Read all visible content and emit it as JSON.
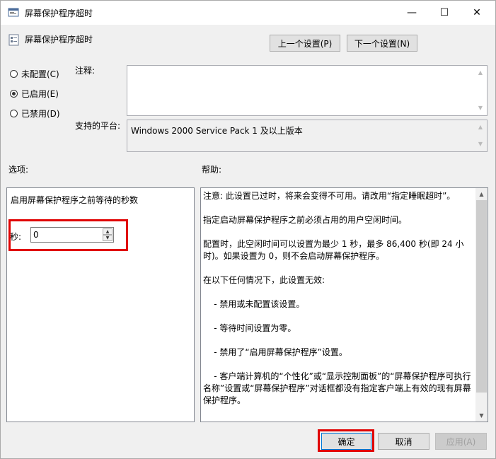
{
  "window": {
    "title": "屏幕保护程序超时",
    "controls": {
      "minimize": "—",
      "maximize": "☐",
      "close": "✕"
    }
  },
  "header": {
    "title": "屏幕保护程序超时",
    "prev_button": "上一个设置(P)",
    "next_button": "下一个设置(N)"
  },
  "state": {
    "options": [
      {
        "label": "未配置(C)",
        "checked": false
      },
      {
        "label": "已启用(E)",
        "checked": true
      },
      {
        "label": "已禁用(D)",
        "checked": false
      }
    ]
  },
  "comment": {
    "label": "注释:",
    "value": ""
  },
  "platform": {
    "label": "支持的平台:",
    "value": "Windows 2000 Service Pack 1 及以上版本"
  },
  "options_section": {
    "label": "选项:",
    "description": "启用屏幕保护程序之前等待的秒数",
    "seconds_label": "秒:",
    "seconds_value": "0"
  },
  "help_section": {
    "label": "帮助:",
    "text": "注意: 此设置已过时，将来会变得不可用。请改用“指定睡眠超时”。\n\n指定启动屏幕保护程序之前必须占用的用户空闲时间。\n\n配置时，此空闲时间可以设置为最少 1 秒，最多 86,400 秒(即 24 小时)。如果设置为 0，则不会启动屏幕保护程序。\n\n在以下任何情况下，此设置无效:\n\n    - 禁用或未配置该设置。\n\n    - 等待时间设置为零。\n\n    - 禁用了“启用屏幕保护程序”设置。\n\n    - 客户端计算机的“个性化”或“显示控制面板”的“屏幕保护程序可执行名称”设置或“屏幕保护程序”对话框都没有指定客户端上有效的现有屏幕保护程序。"
  },
  "footer": {
    "ok": "确定",
    "cancel": "取消",
    "apply": "应用(A)"
  },
  "colors": {
    "highlight": "#e00000",
    "accent": "#0078d7"
  }
}
